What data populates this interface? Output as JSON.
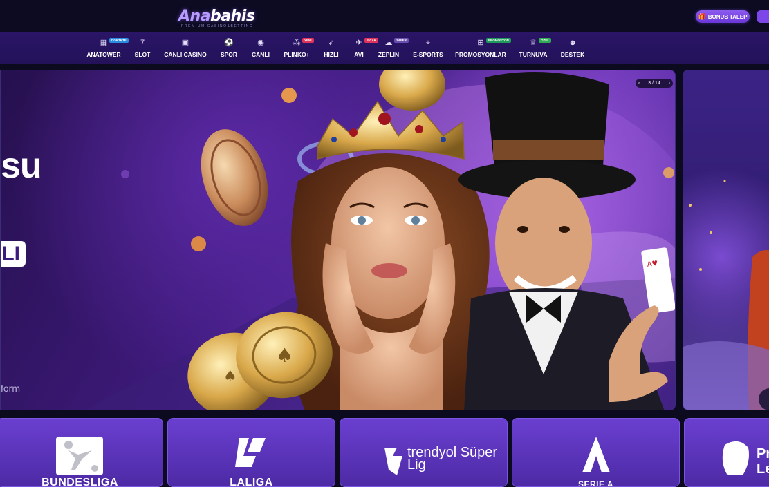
{
  "header": {
    "logo_main": "Ana",
    "logo_bold": "bahis",
    "logo_tagline": "PREMIUM CASINO&BETTING",
    "bonus_button": "BONUS TALEP"
  },
  "nav": {
    "items": [
      {
        "label": "ANATOWER",
        "icon": "tower-icon",
        "badge": "DOKTKTE",
        "badge_color": "#2a8be0"
      },
      {
        "label": "SLOT",
        "icon": "seven-icon",
        "badge": ""
      },
      {
        "label": "CANLI CASINO",
        "icon": "cards-icon",
        "badge": ""
      },
      {
        "label": "SPOR",
        "icon": "ball-icon",
        "badge": ""
      },
      {
        "label": "CANLI",
        "icon": "live-icon",
        "badge": ""
      },
      {
        "label": "PLINKO+",
        "icon": "plinko-icon",
        "badge": "YENİ",
        "badge_color": "#e0335b"
      },
      {
        "label": "HIZLI",
        "icon": "rocket-icon",
        "badge": ""
      },
      {
        "label": "AVI",
        "icon": "plane-icon",
        "badge": "SICAK",
        "badge_color": "#e0335b"
      },
      {
        "label": "ZEPLIN",
        "icon": "zeppelin-icon",
        "badge": "ZAFER",
        "badge_color": "#6a4fb0"
      },
      {
        "label": "E-SPORTS",
        "icon": "gamepad-icon",
        "badge": ""
      },
      {
        "label": "PROMOSYONLAR",
        "icon": "gift-icon",
        "badge": "PROMOSYON",
        "badge_color": "#1f9a5a"
      },
      {
        "label": "TURNUVA",
        "icon": "trophy-icon",
        "badge": "ÖZEL",
        "badge_color": "#2faa55"
      },
      {
        "label": "DESTEK",
        "icon": "support-icon",
        "badge": ""
      }
    ]
  },
  "slider": {
    "headline": "su",
    "button": "LI",
    "subtitle": "form",
    "counter": "3 / 14",
    "prev": "‹",
    "next": "›"
  },
  "leagues": [
    {
      "label": "BUNDESLIGA"
    },
    {
      "label": "LALIGA"
    },
    {
      "label": "trendyol Süper Lig"
    },
    {
      "label": "SERIE A"
    },
    {
      "label": "Pr Le"
    }
  ]
}
